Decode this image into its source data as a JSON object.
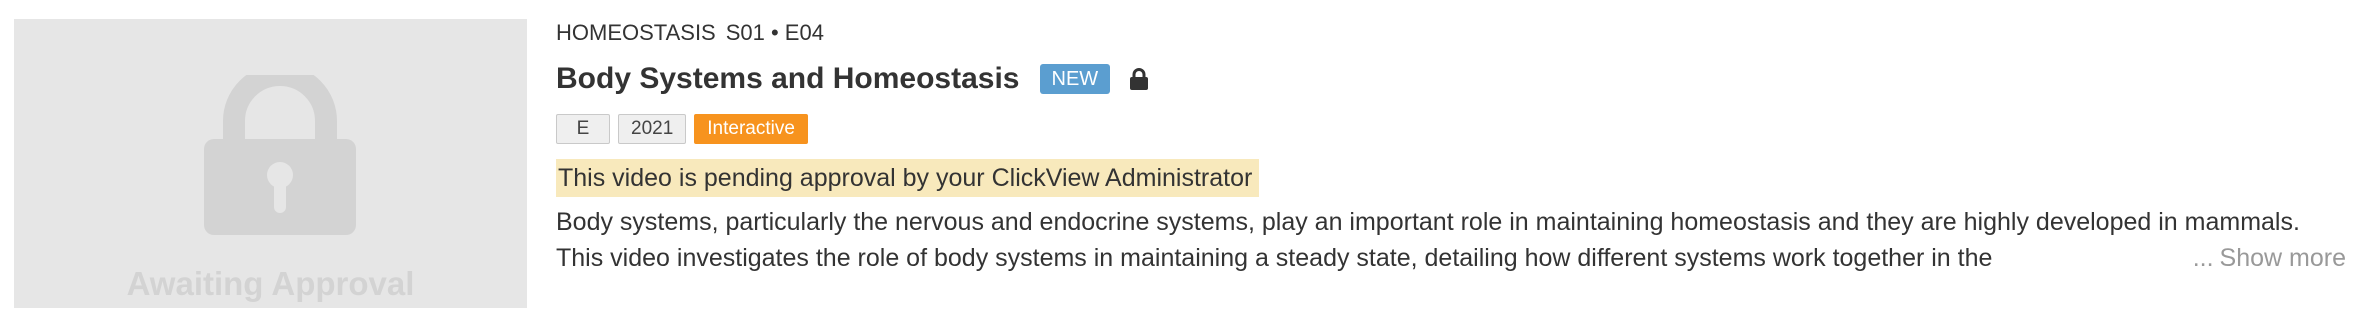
{
  "thumbnail": {
    "status_label": "Awaiting Approval",
    "icon": "lock-icon"
  },
  "series": {
    "name": "HOMEOSTASIS",
    "episode": "S01 • E04"
  },
  "video": {
    "title": "Body Systems and Homeostasis",
    "new_badge": "NEW",
    "lock_icon": "lock-icon"
  },
  "tags": {
    "rating": "E",
    "year": "2021",
    "interactive": "Interactive"
  },
  "pending_notice": "This video is pending approval by your ClickView Administrator",
  "description": {
    "text": "Body systems, particularly the nervous and endocrine systems, play an important role in maintaining homeostasis and they are highly developed in mammals. This video investigates the role of body systems in maintaining a steady state, detailing how different systems work together in the",
    "ellipsis": "...",
    "show_more": "Show more"
  },
  "colors": {
    "new_badge": "#5b9ed0",
    "interactive_tag": "#f7931e",
    "pending_highlight": "#f8e9bc",
    "thumbnail_bg": "#e6e6e6"
  }
}
